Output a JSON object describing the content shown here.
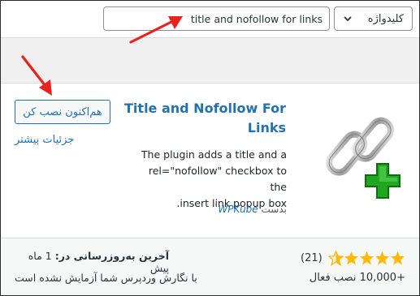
{
  "search": {
    "filter_label": "کلیدواژه",
    "query": "title and nofollow for links"
  },
  "plugin": {
    "title_line1": "Title and Nofollow For",
    "title_line2": "Links",
    "install_label": "هم‌اکنون نصب کن",
    "details_label": "جزئیات بیشتر",
    "description_line1": "The plugin adds a title and a",
    "description_line2": "rel=\"nofollow\" checkbox to the",
    "description_line3": ".insert link popup box",
    "author_prefix": "بدست",
    "author_name": "WPKube"
  },
  "footer": {
    "rating_stars": 5,
    "rating_count": "(21)",
    "installs": "+10,000 نصب فعال",
    "last_updated_label": "آخرین به‌روزرسانی در:",
    "last_updated_value": "1 ماه پیش",
    "compatibility": "با نگارش وردپرس شما آزمایش نشده است"
  },
  "colors": {
    "accent": "#2271b1",
    "star": "#ffb900",
    "arrow": "#e8221c",
    "plus": "#1fa81f"
  }
}
